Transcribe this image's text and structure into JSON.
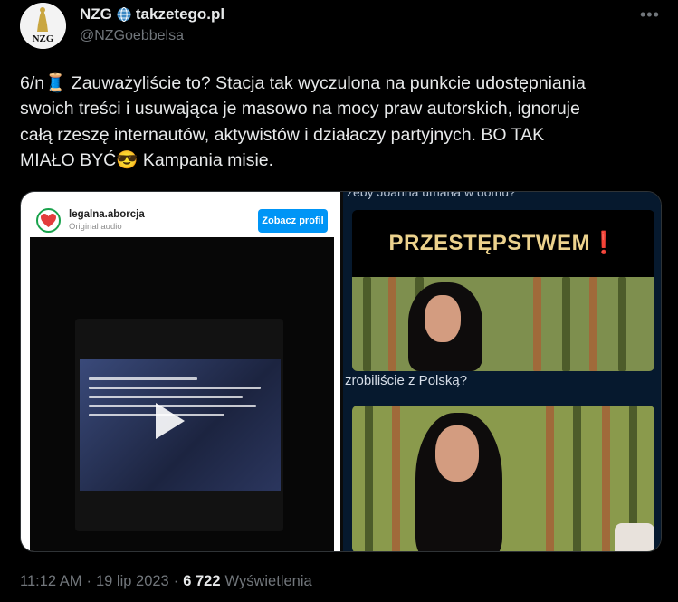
{
  "author": {
    "display_name": "NZG",
    "site_name": "takzetego.pl",
    "handle": "@NZGoebbelsa",
    "avatar_text": "NZG"
  },
  "more_label": "•••",
  "tweet": {
    "line1": "6/n🧵 Zauważyliście to? Stacja tak wyczulona na punkcie udostępniania",
    "line2": "swoich treści i usuwająca je masowo na mocy praw autorskich, ignoruje",
    "line3": "całą rzeszę internautów, aktywistów i działaczy partyjnych. BO TAK",
    "line4": "MIAŁO BYĆ😎 Kampania misie."
  },
  "media": {
    "instagram": {
      "username": "legalna.aborcja",
      "subtitle": "Original audio",
      "button": "Zobacz profil"
    },
    "right": {
      "top_caption": "żeby Joanna umarła w domu?",
      "banner": "PRZESTĘPSTWEM",
      "banner_mark": "❗",
      "mid_caption": "zrobiliście z Polską?"
    }
  },
  "meta": {
    "time": "11:12 AM",
    "sep1": "·",
    "date": "19 lip 2023",
    "sep2": "·",
    "views": "6 722",
    "views_label": "Wyświetlenia"
  },
  "colors": {
    "background": "#000000",
    "text": "#e7e9ea",
    "muted": "#71767b",
    "link_button": "#0095f6",
    "banner_text": "#ecd28d"
  }
}
